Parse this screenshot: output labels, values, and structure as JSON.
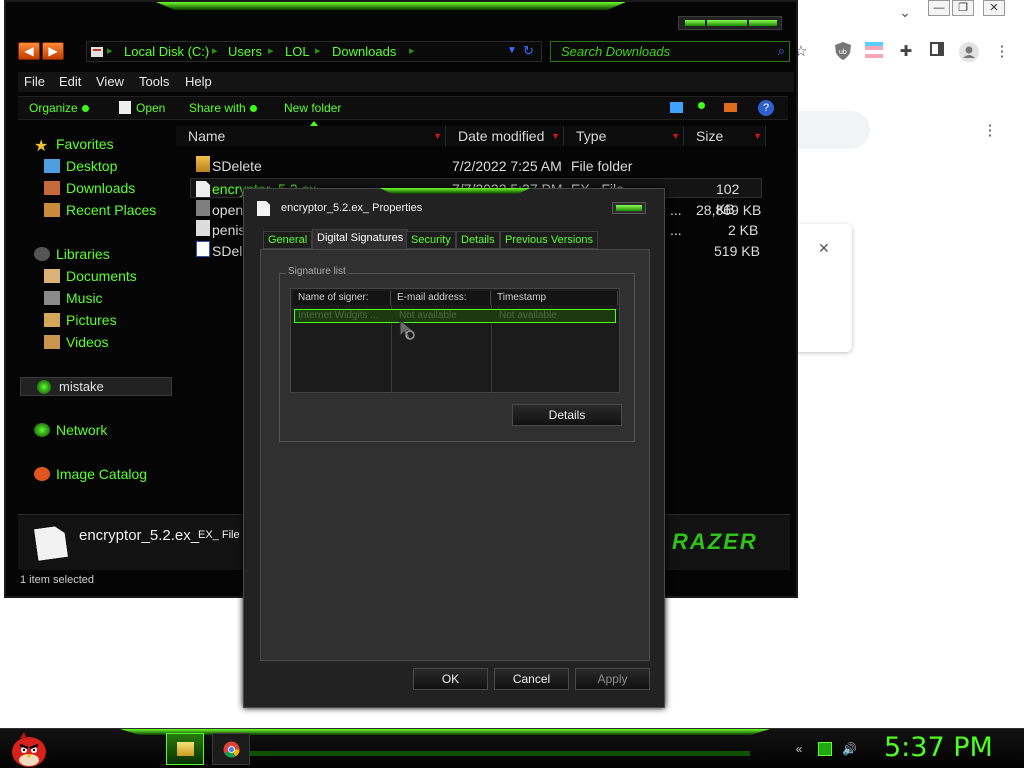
{
  "chrome": {
    "toolbar_icons": [
      "star-icon",
      "shield-icon",
      "colorful-extension-icon",
      "puzzle-icon",
      "sidepanel-icon",
      "account-icon",
      "kebab-menu-icon"
    ]
  },
  "explorer": {
    "breadcrumb": [
      "Local Disk (C:)",
      "Users",
      "LOL",
      "Downloads"
    ],
    "search_placeholder": "Search Downloads",
    "menu": [
      "File",
      "Edit",
      "View",
      "Tools",
      "Help"
    ],
    "commands": [
      "Organize",
      "Open",
      "Share with",
      "New folder"
    ],
    "sidebar": {
      "favorites": "Favorites",
      "desktop": "Desktop",
      "downloads": "Downloads",
      "recent": "Recent Places",
      "libraries": "Libraries",
      "documents": "Documents",
      "music": "Music",
      "pictures": "Pictures",
      "videos": "Videos",
      "homegroup": "mistake",
      "network": "Network",
      "image_catalog": "Image Catalog"
    },
    "columns": [
      "Name",
      "Date modified",
      "Type",
      "Size"
    ],
    "files": [
      {
        "name": "SDelete",
        "date": "7/2/2022 7:25 AM",
        "type": "File folder",
        "size": ""
      },
      {
        "name": "encryptor_5.2.ex_",
        "date": "7/7/2022 5:37 PM",
        "type": "EX_ File",
        "size": "102 KB"
      },
      {
        "name": "openg",
        "date": "",
        "type": "...",
        "size": "28,869 KB"
      },
      {
        "name": "penis",
        "date": "",
        "type": "...",
        "size": "2 KB"
      },
      {
        "name": "SDele",
        "date": "",
        "type": "",
        "size": "519 KB"
      }
    ],
    "details": {
      "filename": "encryptor_5.2.ex_",
      "filetype": "EX_ File D"
    },
    "status": "1 item selected",
    "brand_watermark": "RAZER"
  },
  "dialog": {
    "title": "encryptor_5.2.ex_ Properties",
    "tabs": [
      "General",
      "Digital Signatures",
      "Security",
      "Details",
      "Previous Versions"
    ],
    "active_tab": "Digital Signatures",
    "group_label": "Signature list",
    "sig_columns": [
      "Name of signer:",
      "E-mail address:",
      "Timestamp"
    ],
    "sig_rows": [
      {
        "signer": "Internet Widgits ...",
        "email": "Not available",
        "timestamp": "Not available"
      }
    ],
    "details_button": "Details",
    "ok": "OK",
    "cancel": "Cancel",
    "apply": "Apply"
  },
  "taskbar": {
    "clock": "5:37 PM",
    "accent": "#4dff20"
  }
}
